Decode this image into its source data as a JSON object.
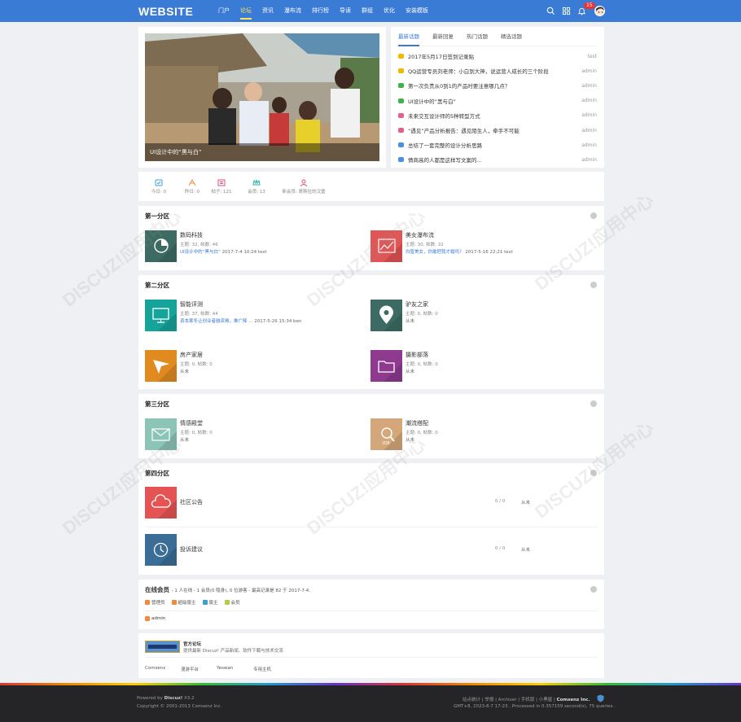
{
  "header": {
    "logo": "WEBSITE",
    "nav": [
      "门户",
      "论坛",
      "资讯",
      "瀑布流",
      "排行榜",
      "导读",
      "群组",
      "优化",
      "安装模板"
    ],
    "active_nav": 1,
    "notice_count": "15"
  },
  "slider": {
    "caption": "UI设计中的“黑与白”"
  },
  "threads": {
    "tabs": [
      "最新话题",
      "最新回复",
      "热门话题",
      "精选话题"
    ],
    "items": [
      {
        "title": "2017年5月17日签到记录贴",
        "author": "test",
        "color": "#f5b800"
      },
      {
        "title": "QQ运营专员刘老师：小白到大神，说运营人成长的三个阶段",
        "author": "admin",
        "color": "#f5b800"
      },
      {
        "title": "第一次负责从0到1的产品时要注意哪几点？",
        "author": "admin",
        "color": "#3cb44b"
      },
      {
        "title": "UI设计中的“黑与白”",
        "author": "admin",
        "color": "#3cb44b"
      },
      {
        "title": "未来交互设计师的5种转型方式",
        "author": "admin",
        "color": "#e85d8c"
      },
      {
        "title": "“遇见”产品分析报告：遇见陌生人，牵手不可能",
        "author": "admin",
        "color": "#e85d8c"
      },
      {
        "title": "总结了一套完整的设计分析思路",
        "author": "admin",
        "color": "#4a90e2"
      },
      {
        "title": "情商高的人都是这样写文案的...",
        "author": "admin",
        "color": "#4a90e2"
      }
    ]
  },
  "stats": [
    {
      "label": "今日: 0",
      "color": "#3a9fe0"
    },
    {
      "label": "昨日: 0",
      "color": "#f08a3c"
    },
    {
      "label": "帖子: 121",
      "color": "#e94e77"
    },
    {
      "label": "会员: 13",
      "color": "#2bb5a8"
    },
    {
      "label": "新会员: 哥斯拉的汉堡",
      "color": "#e94e77"
    }
  ],
  "sections": [
    {
      "title": "第一分区",
      "forums": [
        {
          "name": "数码科技",
          "meta": "主题: 32, 帖数: 46",
          "link": "UI设计中的“黑与白”",
          "time": "2017-7-4 10:24 test",
          "color": "#3d6b63",
          "icon": "pie-chart-icon"
        },
        {
          "name": "美女瀑布流",
          "meta": "主题: 30, 帖数: 31",
          "link": "白皙美女，你敢把我才婚吗？",
          "time": "2017-5-16 22:21 test",
          "color": "#e05555",
          "icon": "line-chart-icon"
        }
      ]
    },
    {
      "title": "第二分区",
      "forums": [
        {
          "name": "智能评测",
          "meta": "主题: 37, 帖数: 44",
          "link": "资本寒冬让创业者融资难，推广降 ...",
          "time": "2017-5-26 15:34 ben",
          "color": "#15a39a",
          "icon": "monitor-icon"
        },
        {
          "name": "驴友之家",
          "meta": "主题: 0, 帖数: 0",
          "link": "",
          "time": "从未",
          "color": "#3d6b63",
          "icon": "map-pin-icon"
        },
        {
          "name": "房产家居",
          "meta": "主题: 0, 帖数: 0",
          "link": "",
          "time": "从未",
          "color": "#e08a20",
          "icon": "send-icon"
        },
        {
          "name": "摄影部落",
          "meta": "主题: 0, 帖数: 0",
          "link": "",
          "time": "从未",
          "color": "#8e3a8e",
          "icon": "folder-icon"
        }
      ]
    },
    {
      "title": "第三分区",
      "forums": [
        {
          "name": "情感殿堂",
          "meta": "主题: 0, 帖数: 0",
          "link": "",
          "time": "从未",
          "color": "#8cc4b8",
          "icon": "mail-icon"
        },
        {
          "name": "潮流搭配",
          "meta": "主题: 0, 帖数: 0",
          "link": "",
          "time": "从未",
          "color": "#d4a77a",
          "icon": "job-search-icon"
        }
      ]
    },
    {
      "title": "第四分区",
      "forums": [
        {
          "name": "社区公告",
          "count": "0 / 0",
          "time": "从未",
          "color": "#e55454",
          "icon": "cloud-icon"
        },
        {
          "name": "投诉建议",
          "count": "0 / 0",
          "time": "从未",
          "color": "#3a6e96",
          "icon": "clock-icon"
        }
      ]
    }
  ],
  "online": {
    "title": "在线会员",
    "summary": "- 1 人在线 - 1 会员(0 隐身), 0 位游客 - 最高记录是 82 于 2017-7-4.",
    "legend": [
      {
        "label": "管理员",
        "color": "#f08a3c"
      },
      {
        "label": "超级版主",
        "color": "#f08a3c"
      },
      {
        "label": "版主",
        "color": "#3a9fe0"
      },
      {
        "label": "会员",
        "color": "#b8c94a"
      }
    ],
    "users": [
      "admin"
    ]
  },
  "links": {
    "official_title": "官方论坛",
    "official_desc": "提供最新 Discuz! 产品新闻、软件下载与技术交流",
    "items": [
      "Comsenz",
      "漫游平台",
      "Yeswan",
      "专用主机"
    ]
  },
  "footer": {
    "powered_prefix": "Powered by",
    "powered_brand": "Discuz!",
    "powered_version": "X3.2",
    "copyright": "Copyright © 2001-2013 Comsenz Inc.",
    "right_links": "站点统计 | 举报 | Archiver | 手机版 | 小黑屋 |",
    "right_brand": "Comsenz Inc.",
    "process": "GMT+8, 2023-8-7 17:23 , Processed in 0.357159 second(s), 75 queries ."
  }
}
